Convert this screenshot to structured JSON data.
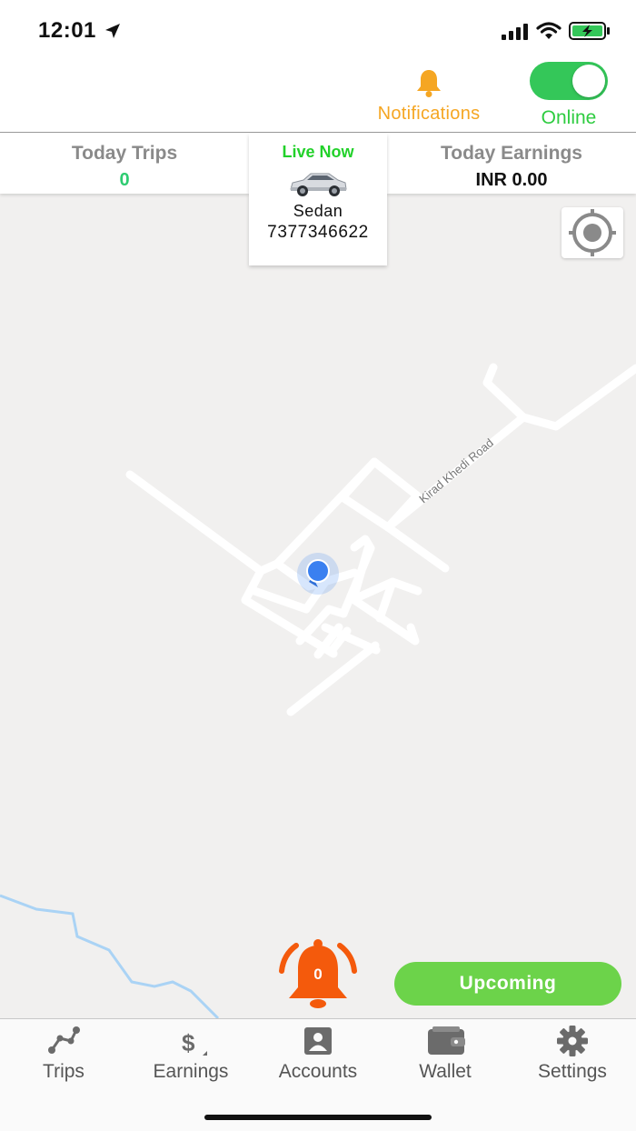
{
  "status_bar": {
    "time": "12:01"
  },
  "header": {
    "notifications_label": "Notifications",
    "online_label": "Online",
    "online_enabled": true
  },
  "stats": {
    "today_trips_label": "Today Trips",
    "today_trips_value": "0",
    "today_earnings_label": "Today Earnings",
    "today_earnings_value": "INR 0.00"
  },
  "live": {
    "label": "Live Now",
    "vehicle_type": "Sedan",
    "vehicle_number": "7377346622"
  },
  "map": {
    "road_label": "Kirad Khedi Road"
  },
  "alert": {
    "count": "0"
  },
  "upcoming_button": {
    "label": "Upcoming"
  },
  "tabs": [
    {
      "label": "Trips",
      "icon": "route-icon"
    },
    {
      "label": "Earnings",
      "icon": "dollar-icon"
    },
    {
      "label": "Accounts",
      "icon": "account-icon"
    },
    {
      "label": "Wallet",
      "icon": "wallet-icon"
    },
    {
      "label": "Settings",
      "icon": "gear-icon"
    }
  ],
  "colors": {
    "online_green": "#34c759",
    "notification_orange": "#f5a623",
    "alert_orange": "#f45a0c",
    "upcoming_green": "#6cd34a",
    "trips_value_green": "#2ecc71",
    "map_bg": "#f1f0ef"
  }
}
